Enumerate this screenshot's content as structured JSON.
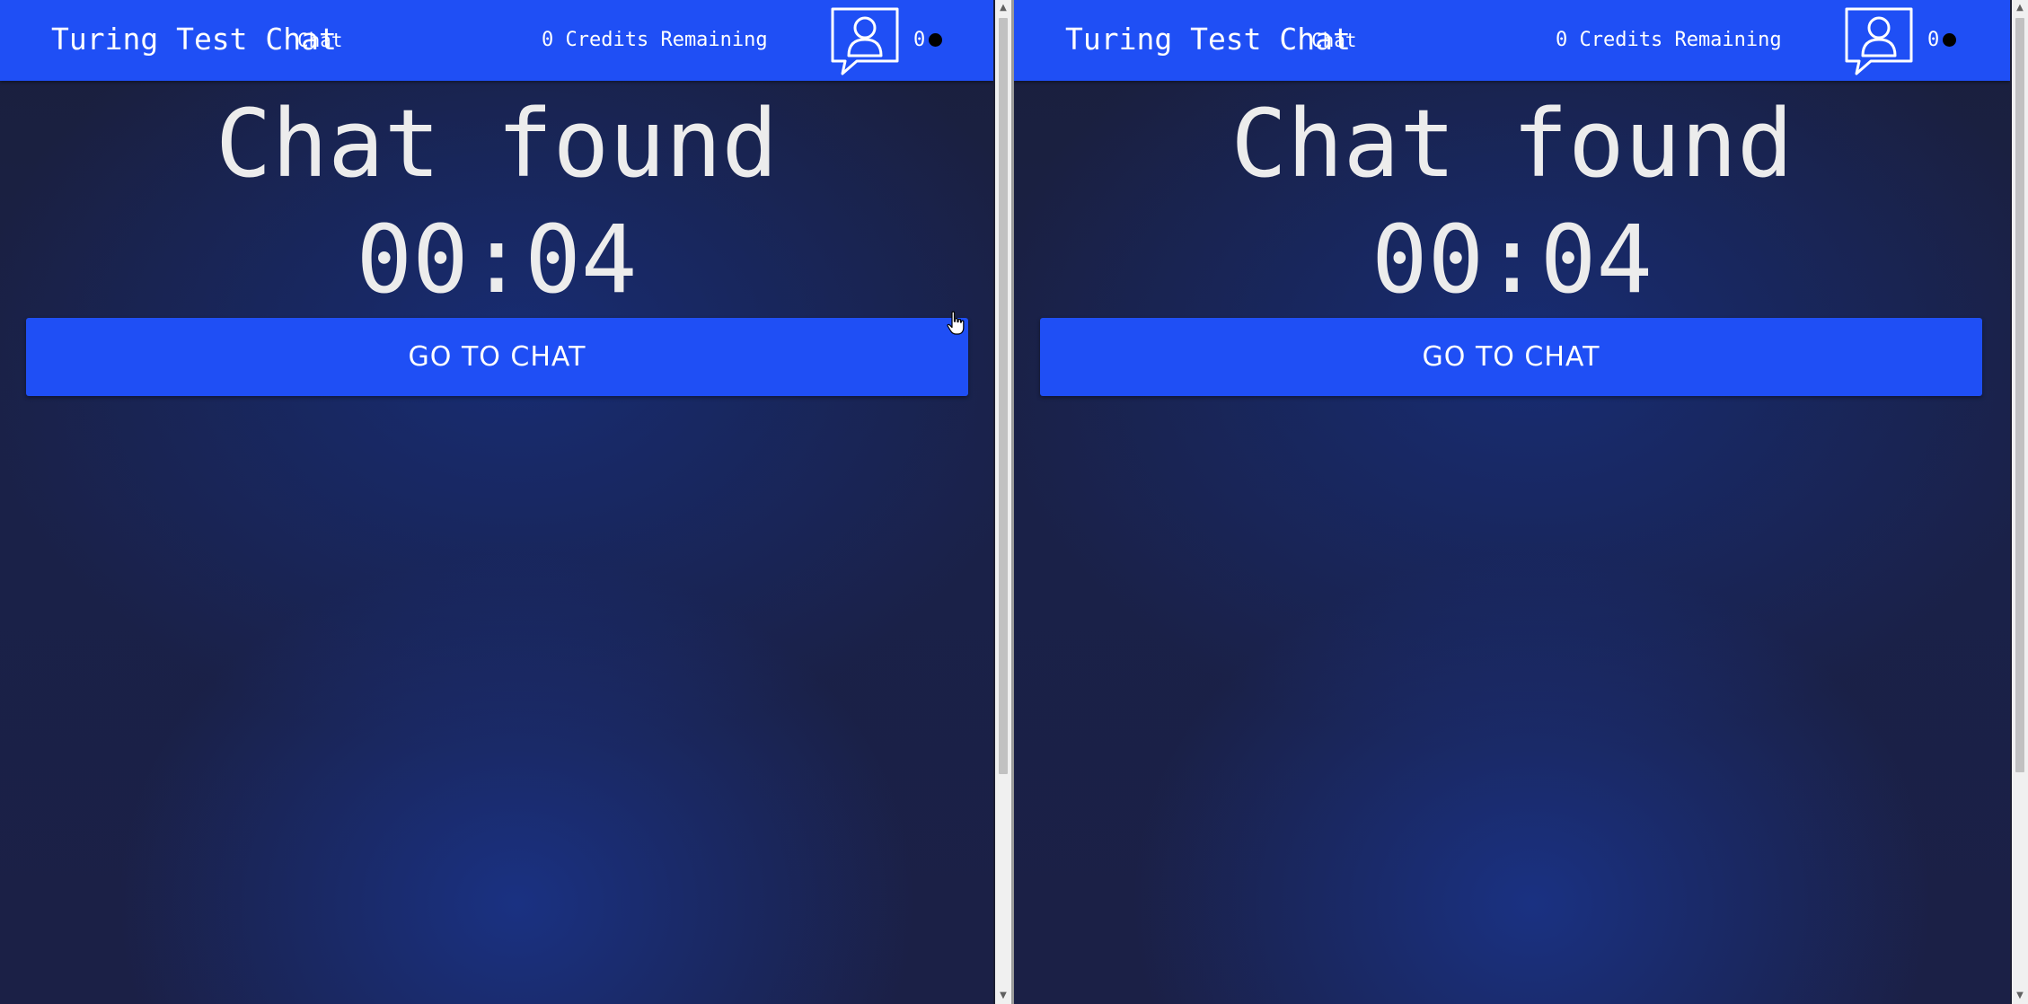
{
  "windows": [
    {
      "navbar": {
        "brand": "Turing Test Chat",
        "link": "Chat",
        "credits": "0 Credits Remaining",
        "avatar_icon": "user-chat-bubble-icon",
        "count": "0",
        "status_color": "#000000"
      },
      "main": {
        "heading": "Chat found",
        "timer": "00:04",
        "button_label": "GO TO CHAT"
      }
    },
    {
      "navbar": {
        "brand": "Turing Test Chat",
        "link": "Chat",
        "credits": "0 Credits Remaining",
        "avatar_icon": "user-chat-bubble-icon",
        "count": "0",
        "status_color": "#000000"
      },
      "main": {
        "heading": "Chat found",
        "timer": "00:04",
        "button_label": "GO TO CHAT"
      }
    }
  ],
  "colors": {
    "accent": "#1f4ff5",
    "background": "#1a2148",
    "text": "#ececec"
  }
}
